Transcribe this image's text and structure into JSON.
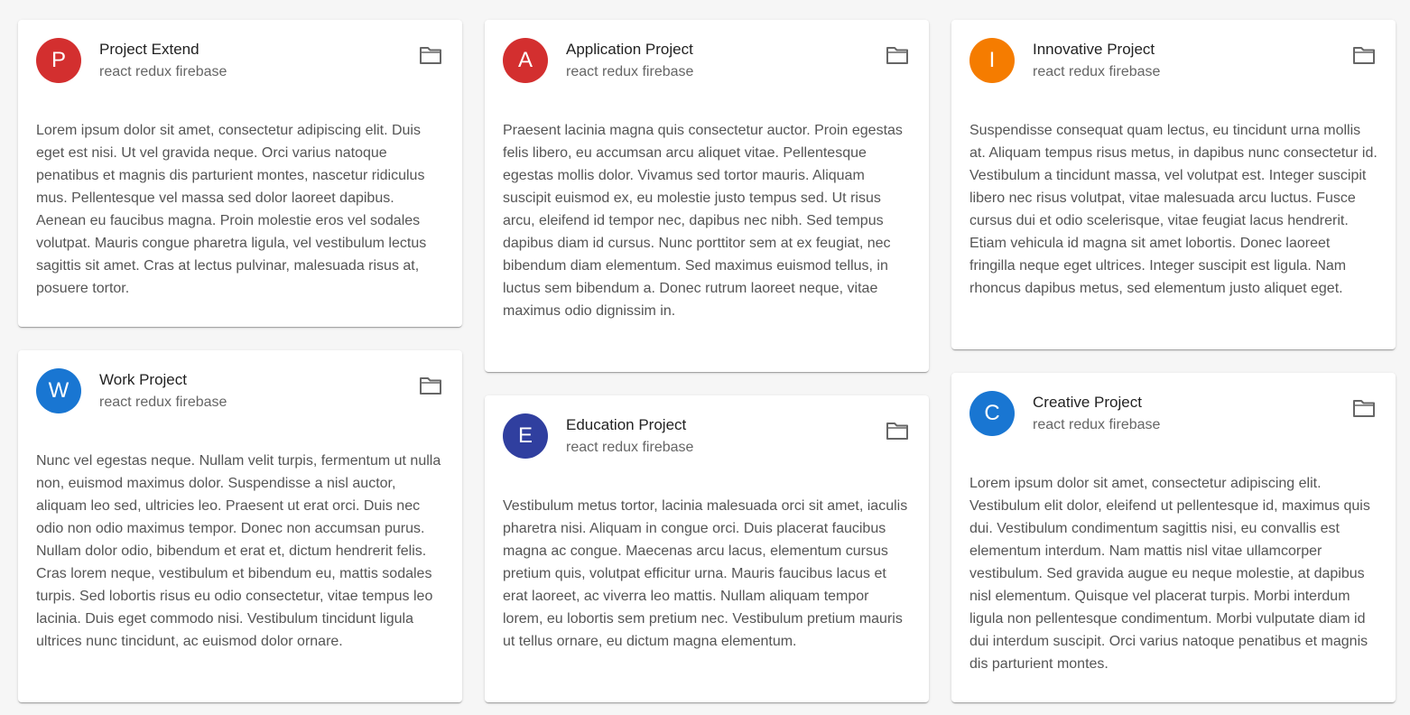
{
  "subtitle": "react redux firebase",
  "cards": [
    {
      "initial": "P",
      "title": "Project Extend",
      "color": "#d32f2f",
      "body": "Lorem ipsum dolor sit amet, consectetur adipiscing elit. Duis eget est nisi. Ut vel gravida neque. Orci varius natoque penatibus et magnis dis parturient montes, nascetur ridiculus mus. Pellentesque vel massa sed dolor laoreet dapibus. Aenean eu faucibus magna. Proin molestie eros vel sodales volutpat. Mauris congue pharetra ligula, vel vestibulum lectus sagittis sit amet. Cras at lectus pulvinar, malesuada risus at, posuere tortor."
    },
    {
      "initial": "W",
      "title": "Work Project",
      "color": "#1976d2",
      "body": "Nunc vel egestas neque. Nullam velit turpis, fermentum ut nulla non, euismod maximus dolor. Suspendisse a nisl auctor, aliquam leo sed, ultricies leo. Praesent ut erat orci. Duis nec odio non odio maximus tempor. Donec non accumsan purus. Nullam dolor odio, bibendum et erat et, dictum hendrerit felis. Cras lorem neque, vestibulum et bibendum eu, mattis sodales turpis. Sed lobortis risus eu odio consectetur, vitae tempus leo lacinia. Duis eget commodo nisi. Vestibulum tincidunt ligula ultrices nunc tincidunt, ac euismod dolor ornare."
    },
    {
      "initial": "A",
      "title": "Application Project",
      "color": "#d32f2f",
      "body": "Praesent lacinia magna quis consectetur auctor. Proin egestas felis libero, eu accumsan arcu aliquet vitae. Pellentesque egestas mollis dolor. Vivamus sed tortor mauris. Aliquam suscipit euismod ex, eu molestie justo tempus sed. Ut risus arcu, eleifend id tempor nec, dapibus nec nibh. Sed tempus dapibus diam id cursus. Nunc porttitor sem at ex feugiat, nec bibendum diam elementum. Sed maximus euismod tellus, in luctus sem bibendum a. Donec rutrum laoreet neque, vitae maximus odio dignissim in."
    },
    {
      "initial": "E",
      "title": "Education Project",
      "color": "#303f9f",
      "body": "Vestibulum metus tortor, lacinia malesuada orci sit amet, iaculis pharetra nisi. Aliquam in congue orci. Duis placerat faucibus magna ac congue. Maecenas arcu lacus, elementum cursus pretium quis, volutpat efficitur urna. Mauris faucibus lacus et erat laoreet, ac viverra leo mattis. Nullam aliquam tempor lorem, eu lobortis sem pretium nec. Vestibulum pretium mauris ut tellus ornare, eu dictum magna elementum."
    },
    {
      "initial": "I",
      "title": "Innovative Project",
      "color": "#f57c00",
      "body": "Suspendisse consequat quam lectus, eu tincidunt urna mollis at. Aliquam tempus risus metus, in dapibus nunc consectetur id. Vestibulum a tincidunt massa, vel volutpat est. Integer suscipit libero nec risus volutpat, vitae malesuada arcu luctus. Fusce cursus dui et odio scelerisque, vitae feugiat lacus hendrerit. Etiam vehicula id magna sit amet lobortis. Donec laoreet fringilla neque eget ultrices. Integer suscipit est ligula. Nam rhoncus dapibus metus, sed elementum justo aliquet eget."
    },
    {
      "initial": "C",
      "title": "Creative Project",
      "color": "#1976d2",
      "body": "Lorem ipsum dolor sit amet, consectetur adipiscing elit. Vestibulum elit dolor, eleifend ut pellentesque id, maximus quis dui. Vestibulum condimentum sagittis nisi, eu convallis est elementum interdum. Nam mattis nisl vitae ullamcorper vestibulum. Sed gravida augue eu neque molestie, at dapibus nisl elementum. Quisque vel placerat turpis. Morbi interdum ligula non pellentesque condimentum. Morbi vulputate diam id dui interdum suscipit. Orci varius natoque penatibus et magnis dis parturient montes."
    }
  ]
}
